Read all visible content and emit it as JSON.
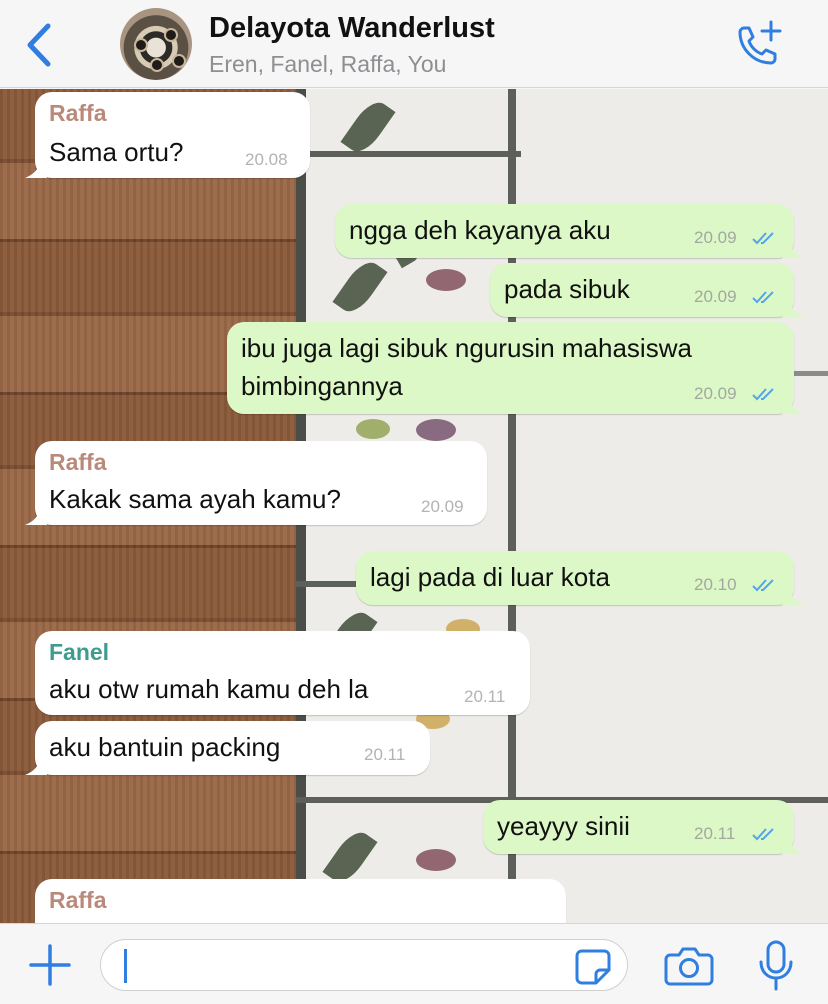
{
  "header": {
    "title": "Delayota Wanderlust",
    "subtitle": "Eren, Fanel, Raffa, You"
  },
  "colors": {
    "accent": "#2f7ee0",
    "outgoing_bubble": "#dcf8c6",
    "incoming_bubble": "#ffffff",
    "raffa_name": "#b9897a",
    "fanel_name": "#3f9b8f",
    "read_ticks": "#53a6e8"
  },
  "icons": {
    "back": "chevron-left-icon",
    "call": "phone-plus-icon",
    "plus": "plus-icon",
    "sticker": "sticker-icon",
    "camera": "camera-icon",
    "mic": "microphone-icon"
  },
  "messages": [
    {
      "direction": "in",
      "sender": "Raffa",
      "lines": [
        "Sama ortu?"
      ],
      "time": "20.08"
    },
    {
      "direction": "out",
      "lines": [
        "ngga deh kayanya aku"
      ],
      "time": "20.09",
      "status": "read"
    },
    {
      "direction": "out",
      "lines": [
        "pada sibuk"
      ],
      "time": "20.09",
      "status": "read"
    },
    {
      "direction": "out",
      "lines": [
        "ibu juga lagi sibuk ngurusin mahasiswa",
        "bimbingannya"
      ],
      "time": "20.09",
      "status": "read"
    },
    {
      "direction": "in",
      "sender": "Raffa",
      "lines": [
        "Kakak sama ayah kamu?"
      ],
      "time": "20.09"
    },
    {
      "direction": "out",
      "lines": [
        "lagi pada di luar kota"
      ],
      "time": "20.10",
      "status": "read"
    },
    {
      "direction": "in",
      "sender": "Fanel",
      "lines": [
        "aku otw rumah kamu deh la"
      ],
      "time": "20.11"
    },
    {
      "direction": "in",
      "lines": [
        "aku bantuin packing"
      ],
      "time": "20.11"
    },
    {
      "direction": "out",
      "lines": [
        "yeayyy sinii"
      ],
      "time": "20.11",
      "status": "read"
    },
    {
      "direction": "in",
      "sender": "Raffa",
      "lines": [],
      "time": ""
    }
  ],
  "composer": {
    "value": "",
    "placeholder": ""
  }
}
